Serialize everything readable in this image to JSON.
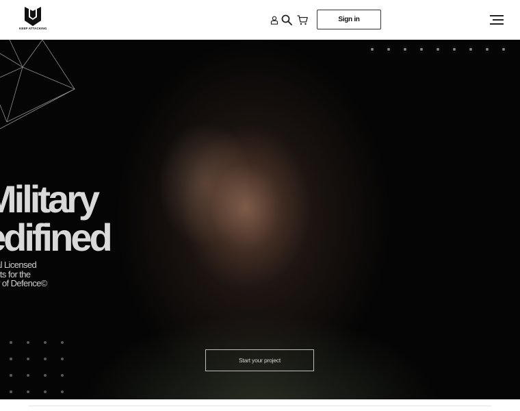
{
  "brand": {
    "wordmark": "KEEP ATTACKING",
    "icon": "shield-book-logo"
  },
  "header": {
    "icons": [
      "user-icon",
      "search-icon",
      "cart-icon"
    ],
    "signin_label": "Sign in",
    "menu_icon": "hamburger-menu-icon"
  },
  "hero": {
    "headline_line1": "Military",
    "headline_line2": "edifined",
    "sub_line1": "al Licensed",
    "sub_line2": "cts for the",
    "sub_line3": "y of Defence©",
    "cta_label": "Start your project"
  },
  "colors": {
    "header_bg": "#ffffff",
    "hero_bg": "#050505",
    "headline": "#d9d9d9",
    "accent_border": "#333333"
  }
}
